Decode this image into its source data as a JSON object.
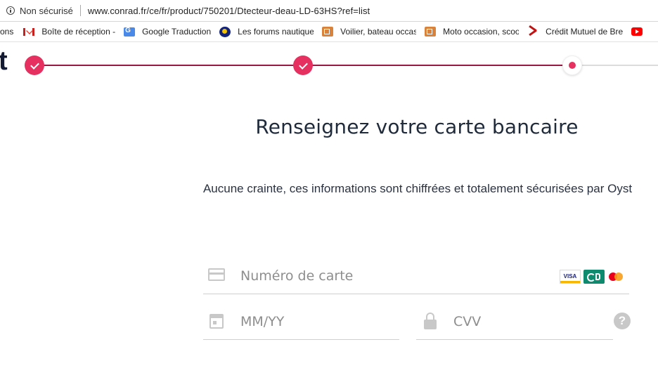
{
  "browser": {
    "security_label": "Non sécurisé",
    "url": "www.conrad.fr/ce/fr/product/750201/Dtecteur-deau-LD-63HS?ref=list"
  },
  "bookmarks": [
    {
      "label": "ons",
      "icon": "none"
    },
    {
      "label": "Boîte de réception -",
      "icon": "gmail-icon"
    },
    {
      "label": "Google Traduction",
      "icon": "google-translate-icon"
    },
    {
      "label": "Les forums nautique",
      "icon": "forum-icon"
    },
    {
      "label": "Voilier, bateau occas",
      "icon": "box-icon"
    },
    {
      "label": "Moto occasion, scoo",
      "icon": "box-icon"
    },
    {
      "label": "Crédit Mutuel de Bre",
      "icon": "pdf-icon"
    },
    {
      "label": "",
      "icon": "youtube-icon"
    }
  ],
  "stepper": {
    "brand_fragment": "t",
    "steps": [
      {
        "state": "done"
      },
      {
        "state": "done"
      },
      {
        "state": "current"
      }
    ]
  },
  "payment": {
    "title": "Renseignez votre carte bancaire",
    "subtitle": "Aucune crainte, ces informations sont chiffrées et totalement sécurisées par Oyst",
    "card_number_placeholder": "Numéro de carte",
    "expiry_placeholder": "MM/YY",
    "cvv_placeholder": "CVV",
    "card_brands": [
      "VISA",
      "CB",
      "Mastercard"
    ],
    "help_symbol": "?"
  },
  "colors": {
    "accent": "#e6305f",
    "progress_line": "#9b1641",
    "title_text": "#1f2a3a"
  }
}
